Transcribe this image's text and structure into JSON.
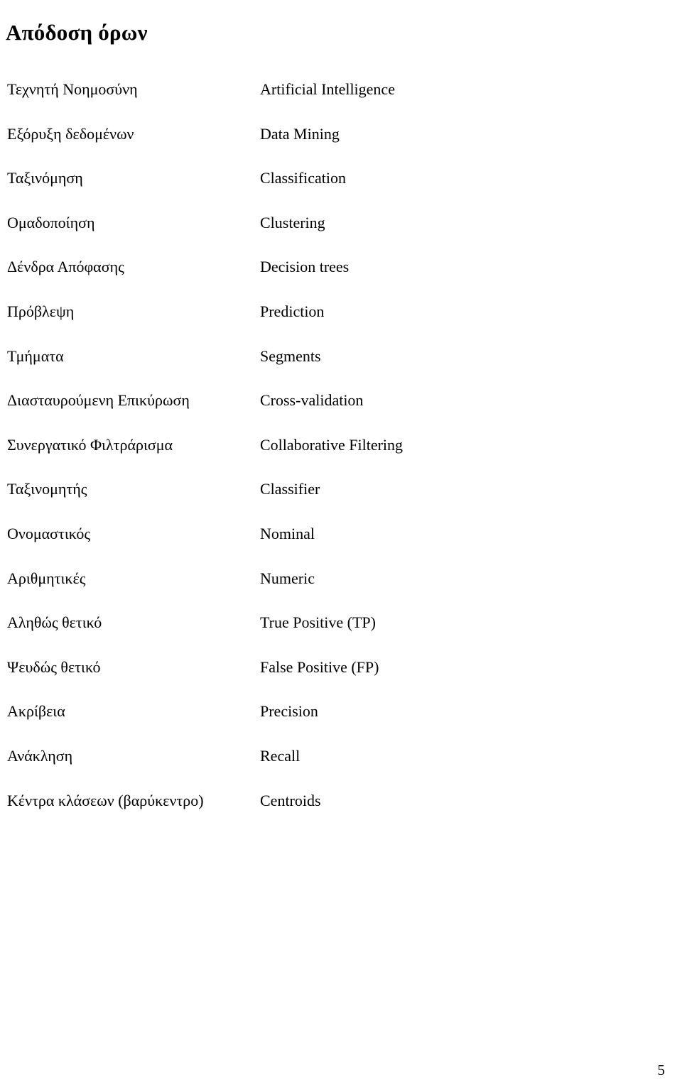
{
  "document": {
    "title": "Απόδοση όρων",
    "page_number": "5",
    "background_color": "#ffffff",
    "text_color": "#000000"
  },
  "glossary": {
    "rows": [
      {
        "greek": "Τεχνητή Νοημοσύνη",
        "english": "Artificial Intelligence"
      },
      {
        "greek": "Εξόρυξη δεδομένων",
        "english": "Data Mining"
      },
      {
        "greek": "Ταξινόμηση",
        "english": "Classification"
      },
      {
        "greek": "Ομαδοποίηση",
        "english": "Clustering"
      },
      {
        "greek": "Δένδρα Απόφασης",
        "english": "Decision trees"
      },
      {
        "greek": "Πρόβλεψη",
        "english": "Prediction"
      },
      {
        "greek": "Τμήματα",
        "english": "Segments"
      },
      {
        "greek": "Διασταυρούμενη Επικύρωση",
        "english": "Cross-validation"
      },
      {
        "greek": "Συνεργατικό Φιλτράρισμα",
        "english": "Collaborative Filtering"
      },
      {
        "greek": "Ταξινομητής",
        "english": "Classifier"
      },
      {
        "greek": "Ονομαστικός",
        "english": "Nominal"
      },
      {
        "greek": "Αριθμητικές",
        "english": "Numeric"
      },
      {
        "greek": "Αληθώς θετικό",
        "english": "True Positive (TP)"
      },
      {
        "greek": "Ψευδώς θετικό",
        "english": "False Positive (FP)"
      },
      {
        "greek": "Ακρίβεια",
        "english": "Precision"
      },
      {
        "greek": "Ανάκληση",
        "english": "Recall"
      },
      {
        "greek": "Κέντρα κλάσεων (βαρύκεντρο)",
        "english": "Centroids"
      }
    ]
  }
}
